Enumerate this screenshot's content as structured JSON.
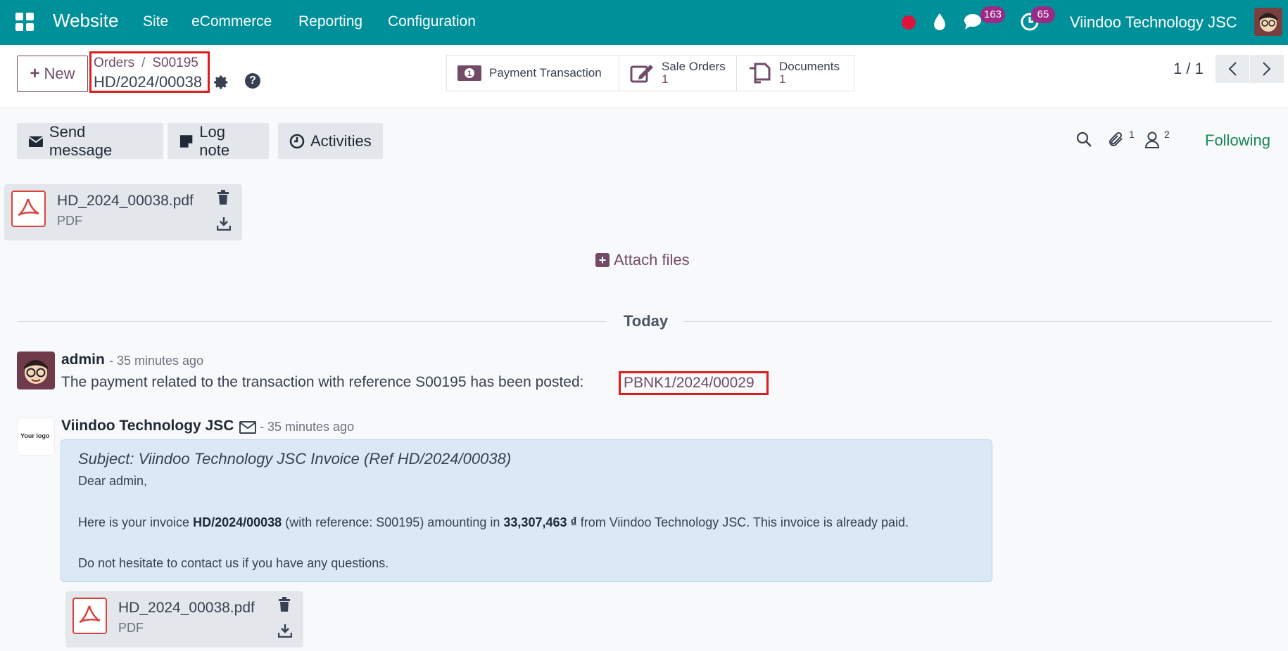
{
  "navbar": {
    "brand": "Website",
    "menu": [
      "Site",
      "eCommerce",
      "Reporting",
      "Configuration"
    ],
    "messages_badge": "163",
    "activities_badge": "65",
    "company": "Viindoo Technology JSC",
    "colors": {
      "bar": "#00909a",
      "badge": "#9b2a86",
      "record_dot": "#dc143c"
    }
  },
  "control": {
    "new_label": "New",
    "breadcrumb_parent": "Orders",
    "breadcrumb_sep": "/",
    "breadcrumb_order": "S00195",
    "record_name": "HD/2024/00038",
    "smart_buttons": [
      {
        "label": "Payment Transaction",
        "count": ""
      },
      {
        "label": "Sale Orders",
        "count": "1"
      },
      {
        "label": "Documents",
        "count": "1"
      }
    ],
    "pager": "1 / 1"
  },
  "chatter": {
    "send_message": "Send message",
    "log_note": "Log note",
    "activities": "Activities",
    "attachments_count": "1",
    "followers_count": "2",
    "following": "Following",
    "attachment": {
      "name": "HD_2024_00038.pdf",
      "type": "PDF"
    },
    "attach_files": "Attach files",
    "date_separator": "Today"
  },
  "messages": [
    {
      "author": "admin",
      "time": "- 35 minutes ago",
      "body": "The payment related to the transaction with reference S00195 has been posted:",
      "link": "PBNK1/2024/00029"
    },
    {
      "author": "Viindoo Technology JSC",
      "time": "- 35 minutes ago",
      "logo_text": "Your logo",
      "subject": "Subject: Viindoo Technology JSC Invoice (Ref HD/2024/00038)",
      "greeting": "Dear admin,",
      "invoice_prefix": "Here is your invoice",
      "invoice_ref": "HD/2024/00038",
      "invoice_mid": "(with reference: S00195) amounting in",
      "amount": "33,307,463 ₫",
      "invoice_suffix": "from Viindoo Technology JSC. This invoice is already paid.",
      "closing": "Do not hesitate to contact us if you have any questions.",
      "attachment": {
        "name": "HD_2024_00038.pdf",
        "type": "PDF"
      }
    }
  ],
  "accent_color": "#714b67",
  "highlight_color": "#e01b1b"
}
